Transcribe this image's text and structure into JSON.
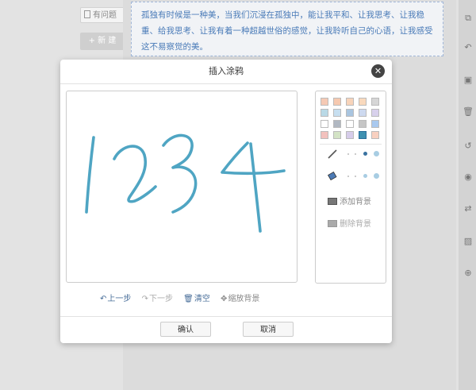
{
  "background": {
    "sidebar_buttons": {
      "issue_label": "有问题",
      "new_label": "+ 新 建"
    },
    "text_block": "孤独有时候是一种美，当我们沉浸在孤独中，能让我平和、让我思考、让我稳重、给我思考、让我有着一种超越世俗的感觉，让我聆听自己的心语，让我感受这不易察觉的美。",
    "right_toolbar": [
      "copy-icon",
      "undo-icon",
      "save-icon",
      "delete-icon",
      "history-icon",
      "preview-icon",
      "swap-icon",
      "image-icon",
      "zoom-icon"
    ]
  },
  "dialog": {
    "title": "插入涂鸦",
    "close_symbol": "✕",
    "canvas_drawing_text": "1234",
    "stroke_color": "#4fa5c3",
    "palette": {
      "colors": [
        "#f5c9b4",
        "#f6c9b0",
        "#f8d4ba",
        "#f9d9bd",
        "#d6d6d6",
        "#b9d9e6",
        "#c7dff0",
        "#a9c5e0",
        "#cdd9ef",
        "#d8d1ec",
        "#ffffff",
        "#b1b8c2",
        "#ffffff",
        "#c6c6c6",
        "#a9c9ef",
        "#f2c1bd",
        "#d3e3c5",
        "#d6ccea",
        "#3e90b0",
        "#f8d0c0"
      ],
      "selected_index": 18,
      "add_background": "添加背景",
      "remove_background": "删除背景"
    },
    "actions": {
      "undo": "上一步",
      "redo": "下一步",
      "clear": "清空",
      "zoom_background": "缩放背景"
    },
    "confirm": "确认",
    "cancel": "取消"
  }
}
